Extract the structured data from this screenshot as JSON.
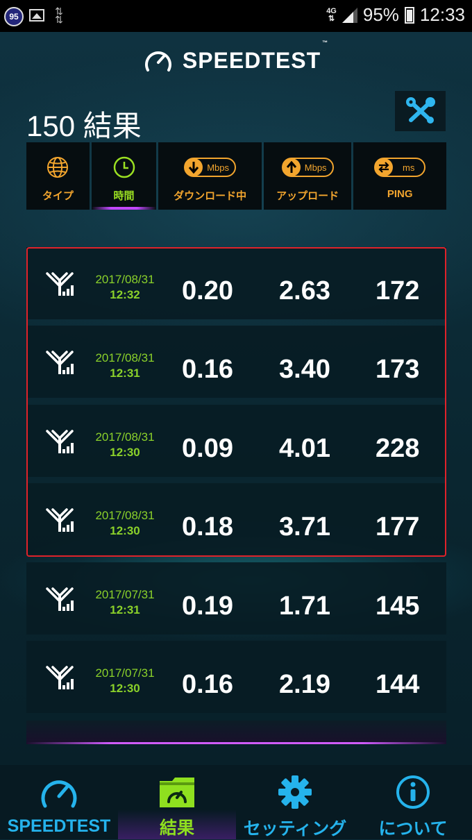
{
  "status_bar": {
    "notification_badge": "95",
    "network": "4G",
    "battery": "95%",
    "time": "12:33"
  },
  "header": {
    "logo_text": "SPEEDTEST",
    "trademark": "™"
  },
  "results": {
    "count_label": "150 結果"
  },
  "tabs": [
    {
      "label": "タイプ",
      "icon": "globe-icon"
    },
    {
      "label": "時間",
      "icon": "clock-icon"
    },
    {
      "label": "ダウンロード中",
      "unit": "Mbps",
      "icon": "download-arrow-icon"
    },
    {
      "label": "アップロード",
      "unit": "Mbps",
      "icon": "upload-arrow-icon"
    },
    {
      "label": "PING",
      "unit": "ms",
      "icon": "ping-arrows-icon"
    }
  ],
  "rows": [
    {
      "date": "2017/08/31",
      "time": "12:32",
      "download": "0.20",
      "upload": "2.63",
      "ping": "172"
    },
    {
      "date": "2017/08/31",
      "time": "12:31",
      "download": "0.16",
      "upload": "3.40",
      "ping": "173"
    },
    {
      "date": "2017/08/31",
      "time": "12:30",
      "download": "0.09",
      "upload": "4.01",
      "ping": "228"
    },
    {
      "date": "2017/08/31",
      "time": "12:30",
      "download": "0.18",
      "upload": "3.71",
      "ping": "177"
    },
    {
      "date": "2017/07/31",
      "time": "12:31",
      "download": "0.19",
      "upload": "1.71",
      "ping": "145"
    },
    {
      "date": "2017/07/31",
      "time": "12:30",
      "download": "0.16",
      "upload": "2.19",
      "ping": "144"
    }
  ],
  "nav": [
    {
      "label": "SPEEDTEST",
      "icon": "speedometer-icon"
    },
    {
      "label": "結果",
      "icon": "results-folder-icon"
    },
    {
      "label": "セッティング",
      "icon": "gear-icon"
    },
    {
      "label": "について",
      "icon": "info-icon"
    }
  ],
  "colors": {
    "accent_orange": "#f2a52e",
    "accent_green": "#8bd12a",
    "accent_blue": "#25b3ec",
    "highlight_red": "#e0222a"
  }
}
